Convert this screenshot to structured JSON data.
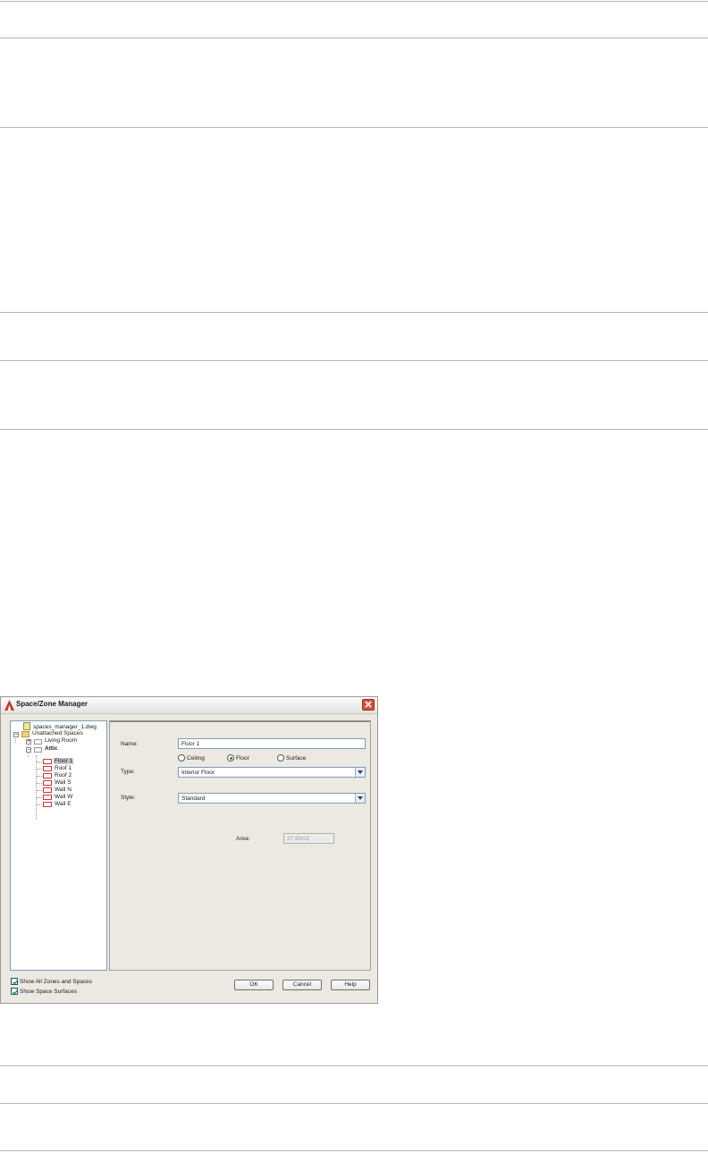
{
  "dialog": {
    "title": "Space/Zone Manager",
    "tree": {
      "root": "spaces_manager_1.dwg",
      "unattached": "Unattached Spaces",
      "living_room": "Living Room",
      "attic": "Attic",
      "surfaces": [
        "Floor 1",
        "Roof 1",
        "Roof 2",
        "Wall S",
        "Wall N",
        "Wall W",
        "Wall E"
      ],
      "selected": "Floor 1"
    },
    "props": {
      "name_label": "Name:",
      "name_value": "Floor 1",
      "radio_ceiling": "Ceiling",
      "radio_floor": "Floor",
      "radio_surface": "Surface",
      "radio_selected": "Floor",
      "type_label": "Type:",
      "type_value": "Interior Floor",
      "style_label": "Style:",
      "style_value": "Standard",
      "area_label": "Area:",
      "area_value": "37.90m2"
    },
    "footer": {
      "show_all": "Show All Zones and Spaces",
      "show_all_checked": true,
      "show_surfaces": "Show Space Surfaces",
      "show_surfaces_checked": true,
      "ok": "OK",
      "cancel": "Cancel",
      "help": "Help"
    }
  },
  "colors": {
    "dialog_bg": "#ece9e2",
    "close_red": "#d9513c",
    "selection": "#c4c4c4"
  }
}
